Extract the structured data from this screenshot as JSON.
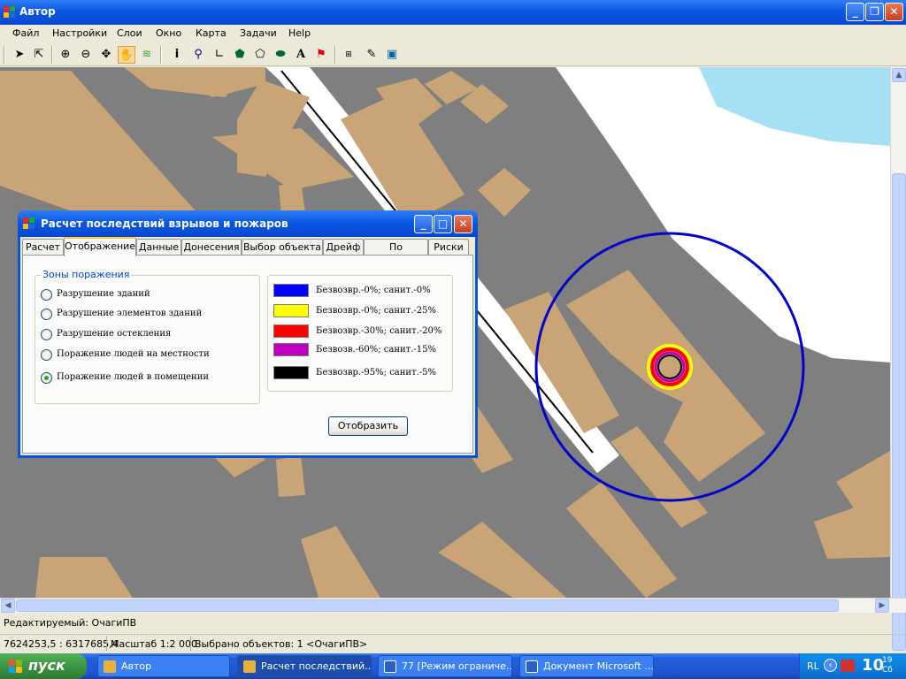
{
  "window": {
    "title": "Автор"
  },
  "menu": [
    "Файл",
    "Настройки",
    "Слои",
    "Окно",
    "Карта",
    "Задачи",
    "Help"
  ],
  "toolbar_icons": [
    "select-arrow-icon",
    "select-multi-icon",
    "zoom-in-icon",
    "zoom-out-icon",
    "pan-move-icon",
    "hand-icon",
    "layers-icon",
    "info-icon",
    "pin-icon",
    "polyline-icon",
    "polygon-icon",
    "polygon-outline-icon",
    "ellipse-icon",
    "text-icon",
    "flag-icon",
    "scale-icon",
    "edit-icon",
    "image-icon"
  ],
  "dialog": {
    "title": "Расчет последствий взрывов и пожаров",
    "tabs": [
      "Расчет",
      "Отображение",
      "Данные",
      "Донесения",
      "Выбор объекта",
      "Дрейф",
      "По площади",
      "Риски"
    ],
    "active_tab": "Отображение",
    "group_title": "Зоны поражения",
    "options": [
      "Разрушение зданий",
      "Разрушение элементов зданий",
      "Разрушение остекления",
      "Поражение людей на местности",
      "Поражение людей в помещении"
    ],
    "selected_option": "Поражение людей в помещении",
    "legend": [
      {
        "color": "#0000ff",
        "label": "Безвозвр.-0%; санит.-0%"
      },
      {
        "color": "#ffff00",
        "label": "Безвозвр.-0%; санит.-25%"
      },
      {
        "color": "#ff0000",
        "label": "Безвозвр.-30%; санит.-20%"
      },
      {
        "color": "#c000c0",
        "label": "Безвозв.-60%; санит.-15%"
      },
      {
        "color": "#000000",
        "label": "Безвозвр.-95%; санит.-5%"
      }
    ],
    "show_button": "Отобразить"
  },
  "status": {
    "editable": "Редактируемый: ОчагиПВ",
    "coords": "7624253,5 : 6317685,4",
    "scale": "Масштаб 1:2 000",
    "selected": "Выбрано объектов: 1 <ОчагиПВ>"
  },
  "taskbar": {
    "start": "пуск",
    "tasks": [
      "Автор",
      "Расчет последствий...",
      "77 [Режим ограниче...",
      "Документ Microsoft ..."
    ],
    "lang": "RL",
    "time": "10",
    "time_small": "19",
    "day": "Сб"
  },
  "colors": {
    "map_bg": "#7f7f7f",
    "building": "#c8a477",
    "water": "#a6e0f5",
    "zone_outer": "#0000cc"
  }
}
